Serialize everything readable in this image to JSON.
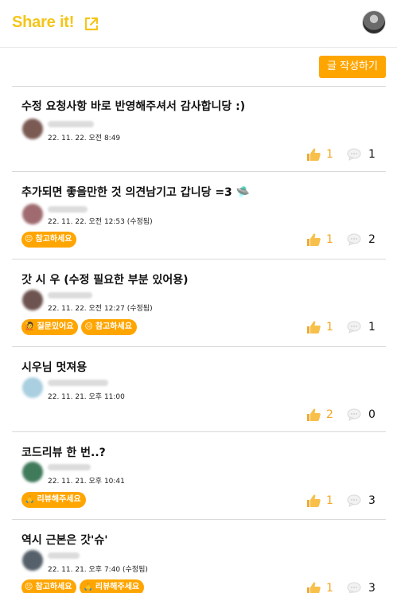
{
  "header": {
    "logo": "Share it!"
  },
  "toolbar": {
    "write_label": "글 작성하기"
  },
  "posts": [
    {
      "title": "수정 요청사항 바로 반영해주셔서 감사합니당 :)",
      "date": "22. 11. 22. 오전 8:49",
      "tags": [],
      "likes": "1",
      "comments": "1",
      "avatar_color": "#7a5a52"
    },
    {
      "title": "추가되면 좋을만한 것 의견남기고 갑니당 =3 🛸",
      "date": "22. 11. 22. 오전 12:53 (수정됨)",
      "tags": [
        {
          "emoji": "😐",
          "label": "참고하세요"
        }
      ],
      "likes": "1",
      "comments": "2",
      "avatar_color": "#a06b70"
    },
    {
      "title": "갓 시 우 (수정 필요한 부분 있어용)",
      "date": "22. 11. 22. 오전 12:27 (수정됨)",
      "tags": [
        {
          "emoji": "🙋",
          "label": "질문있어요"
        },
        {
          "emoji": "😐",
          "label": "참고하세요"
        }
      ],
      "likes": "1",
      "comments": "1",
      "avatar_color": "#6e5450"
    },
    {
      "title": "시우님 멋져용",
      "date": "22. 11. 21. 오후 11:00",
      "tags": [],
      "likes": "2",
      "comments": "0",
      "avatar_color": "#a9cfe0"
    },
    {
      "title": "코드리뷰 한 번..?",
      "date": "22. 11. 21. 오후 10:41",
      "tags": [
        {
          "emoji": "🙏",
          "label": "리뷰해주세요"
        }
      ],
      "likes": "1",
      "comments": "3",
      "avatar_color": "#3f7a5a"
    },
    {
      "title": "역시 근본은 갓'슈'",
      "date": "22. 11. 21. 오후 7:40 (수정됨)",
      "tags": [
        {
          "emoji": "😐",
          "label": "참고하세요"
        },
        {
          "emoji": "🙏",
          "label": "리뷰해주세요"
        }
      ],
      "likes": "1",
      "comments": "3",
      "avatar_color": "#55606a"
    }
  ]
}
